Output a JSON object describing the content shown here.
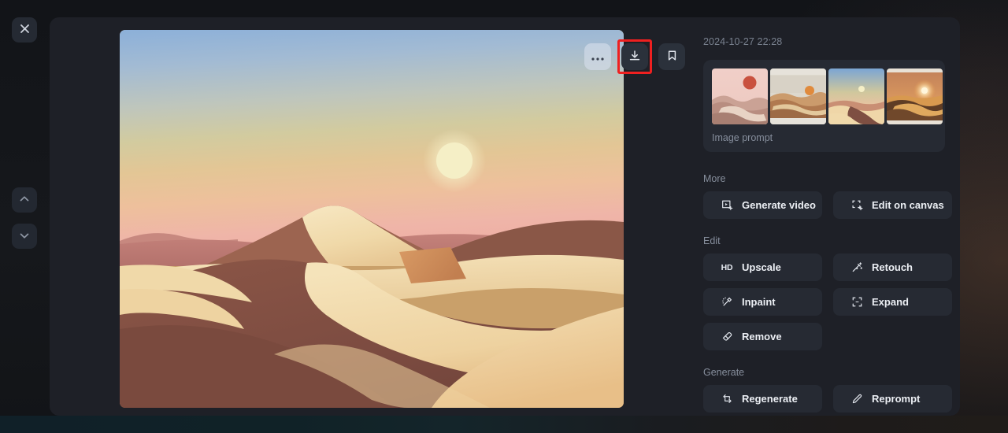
{
  "rail": {
    "close_label": "Close",
    "prev_label": "Previous image",
    "next_label": "Next image"
  },
  "image_toolbar": {
    "more_label": "More options",
    "download_label": "Download",
    "bookmark_label": "Bookmark",
    "highlight_color": "#ef2020",
    "highlighted_action": "download"
  },
  "side_panel": {
    "timestamp": "2024-10-27 22:28",
    "image_prompt_label": "Image prompt",
    "thumbnails": [
      {
        "name": "thumbnail-1"
      },
      {
        "name": "thumbnail-2"
      },
      {
        "name": "thumbnail-3"
      },
      {
        "name": "thumbnail-4"
      }
    ],
    "sections": [
      {
        "label": "More",
        "actions": [
          {
            "label": "Generate video",
            "icon": "video-plus-icon"
          },
          {
            "label": "Edit on canvas",
            "icon": "canvas-frame-icon"
          }
        ]
      },
      {
        "label": "Edit",
        "actions": [
          {
            "label": "Upscale",
            "icon": "hd-icon"
          },
          {
            "label": "Retouch",
            "icon": "magic-wand-icon"
          },
          {
            "label": "Inpaint",
            "icon": "inpaint-brush-icon"
          },
          {
            "label": "Expand",
            "icon": "expand-frame-icon"
          },
          {
            "label": "Remove",
            "icon": "eraser-icon"
          }
        ]
      },
      {
        "label": "Generate",
        "actions": [
          {
            "label": "Regenerate",
            "icon": "refresh-icon"
          },
          {
            "label": "Reprompt",
            "icon": "pencil-icon"
          }
        ]
      }
    ]
  },
  "hero_image": {
    "alt": "Desert sand dunes at sunset with pale sun over rolling dunes",
    "sky_top": "#8fb1d8",
    "sky_mid": "#cfcf9f",
    "sky_low": "#f0c0ac",
    "sun_color": "#f5efc4",
    "dune_light": "#f2dcaf",
    "dune_mid": "#d9a777",
    "dune_shadow": "#7e4f42"
  }
}
